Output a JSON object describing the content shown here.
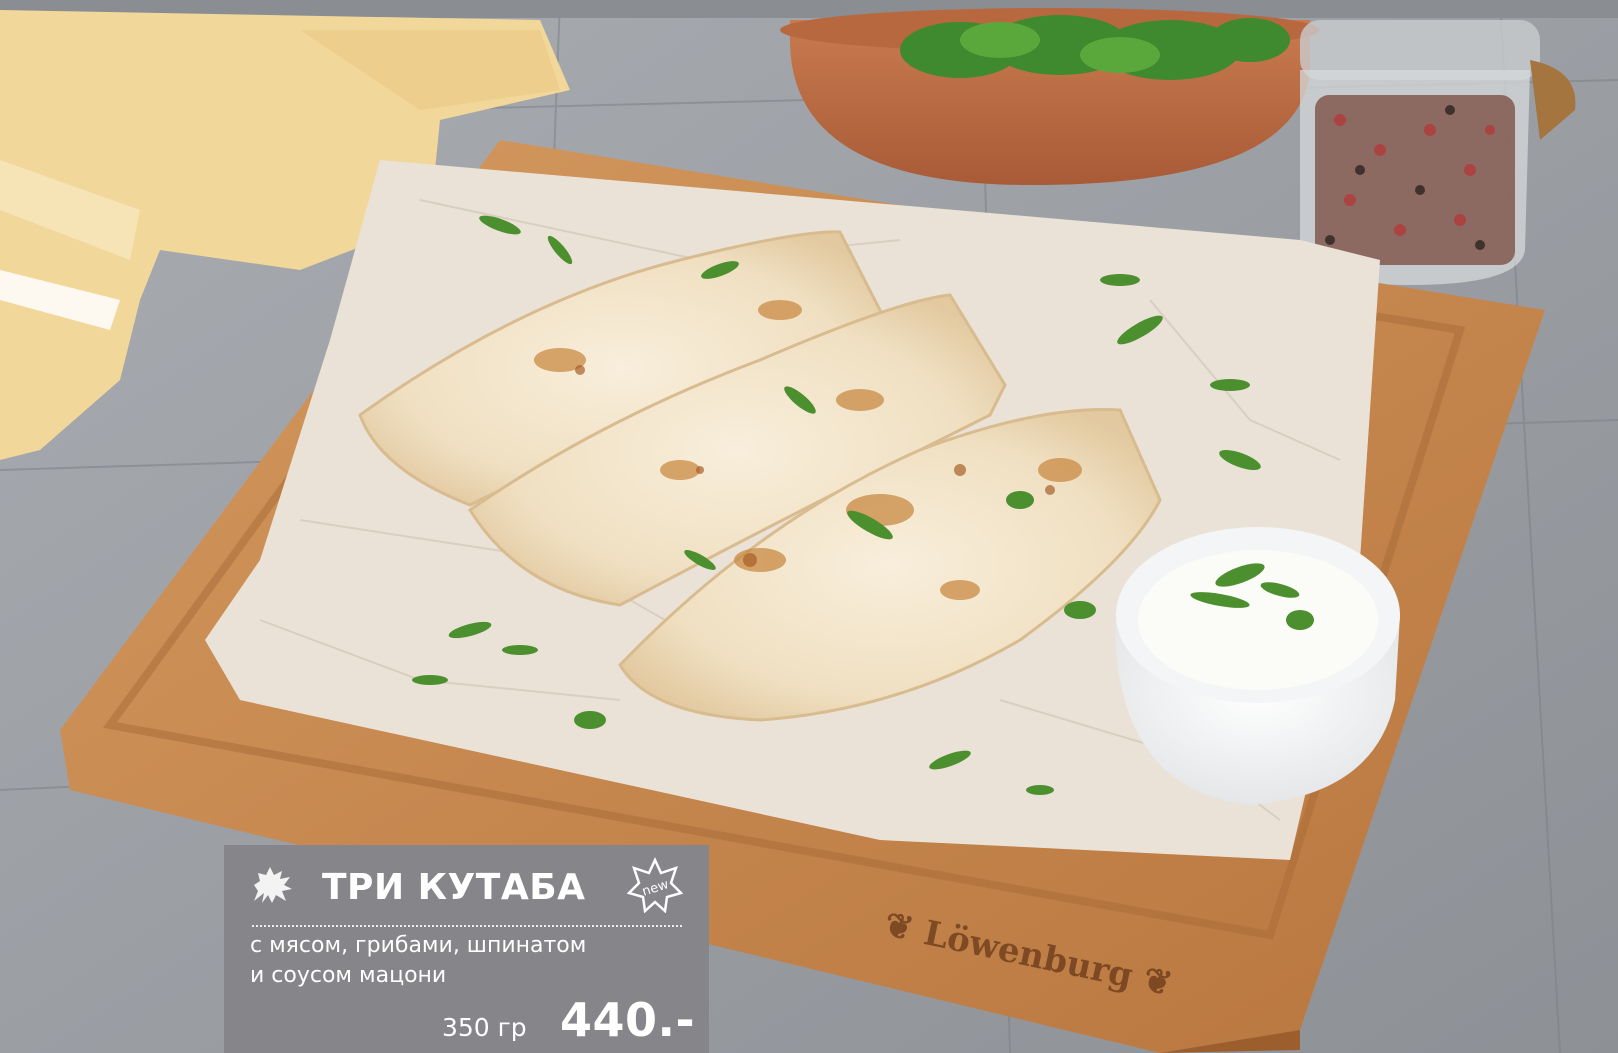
{
  "menu_item": {
    "title": "ТРИ КУТАБА",
    "description_line_1": "с мясом, грибами, шпинатом",
    "description_line_2": "и соусом мацони",
    "weight": "350 гр",
    "price": "440.-",
    "badge_text": "new"
  },
  "board": {
    "brand_mark": "Löwenburg"
  },
  "icons": {
    "brand": "heraldic-lion-icon",
    "badge": "new-star-icon"
  },
  "colors": {
    "card_bg": "#85858a",
    "card_text": "#ffffff",
    "table_wood": "#9a9ea3",
    "board_wood": "#c98b4f",
    "parchment": "#e8dfd3",
    "napkin": "#f2d79a"
  }
}
